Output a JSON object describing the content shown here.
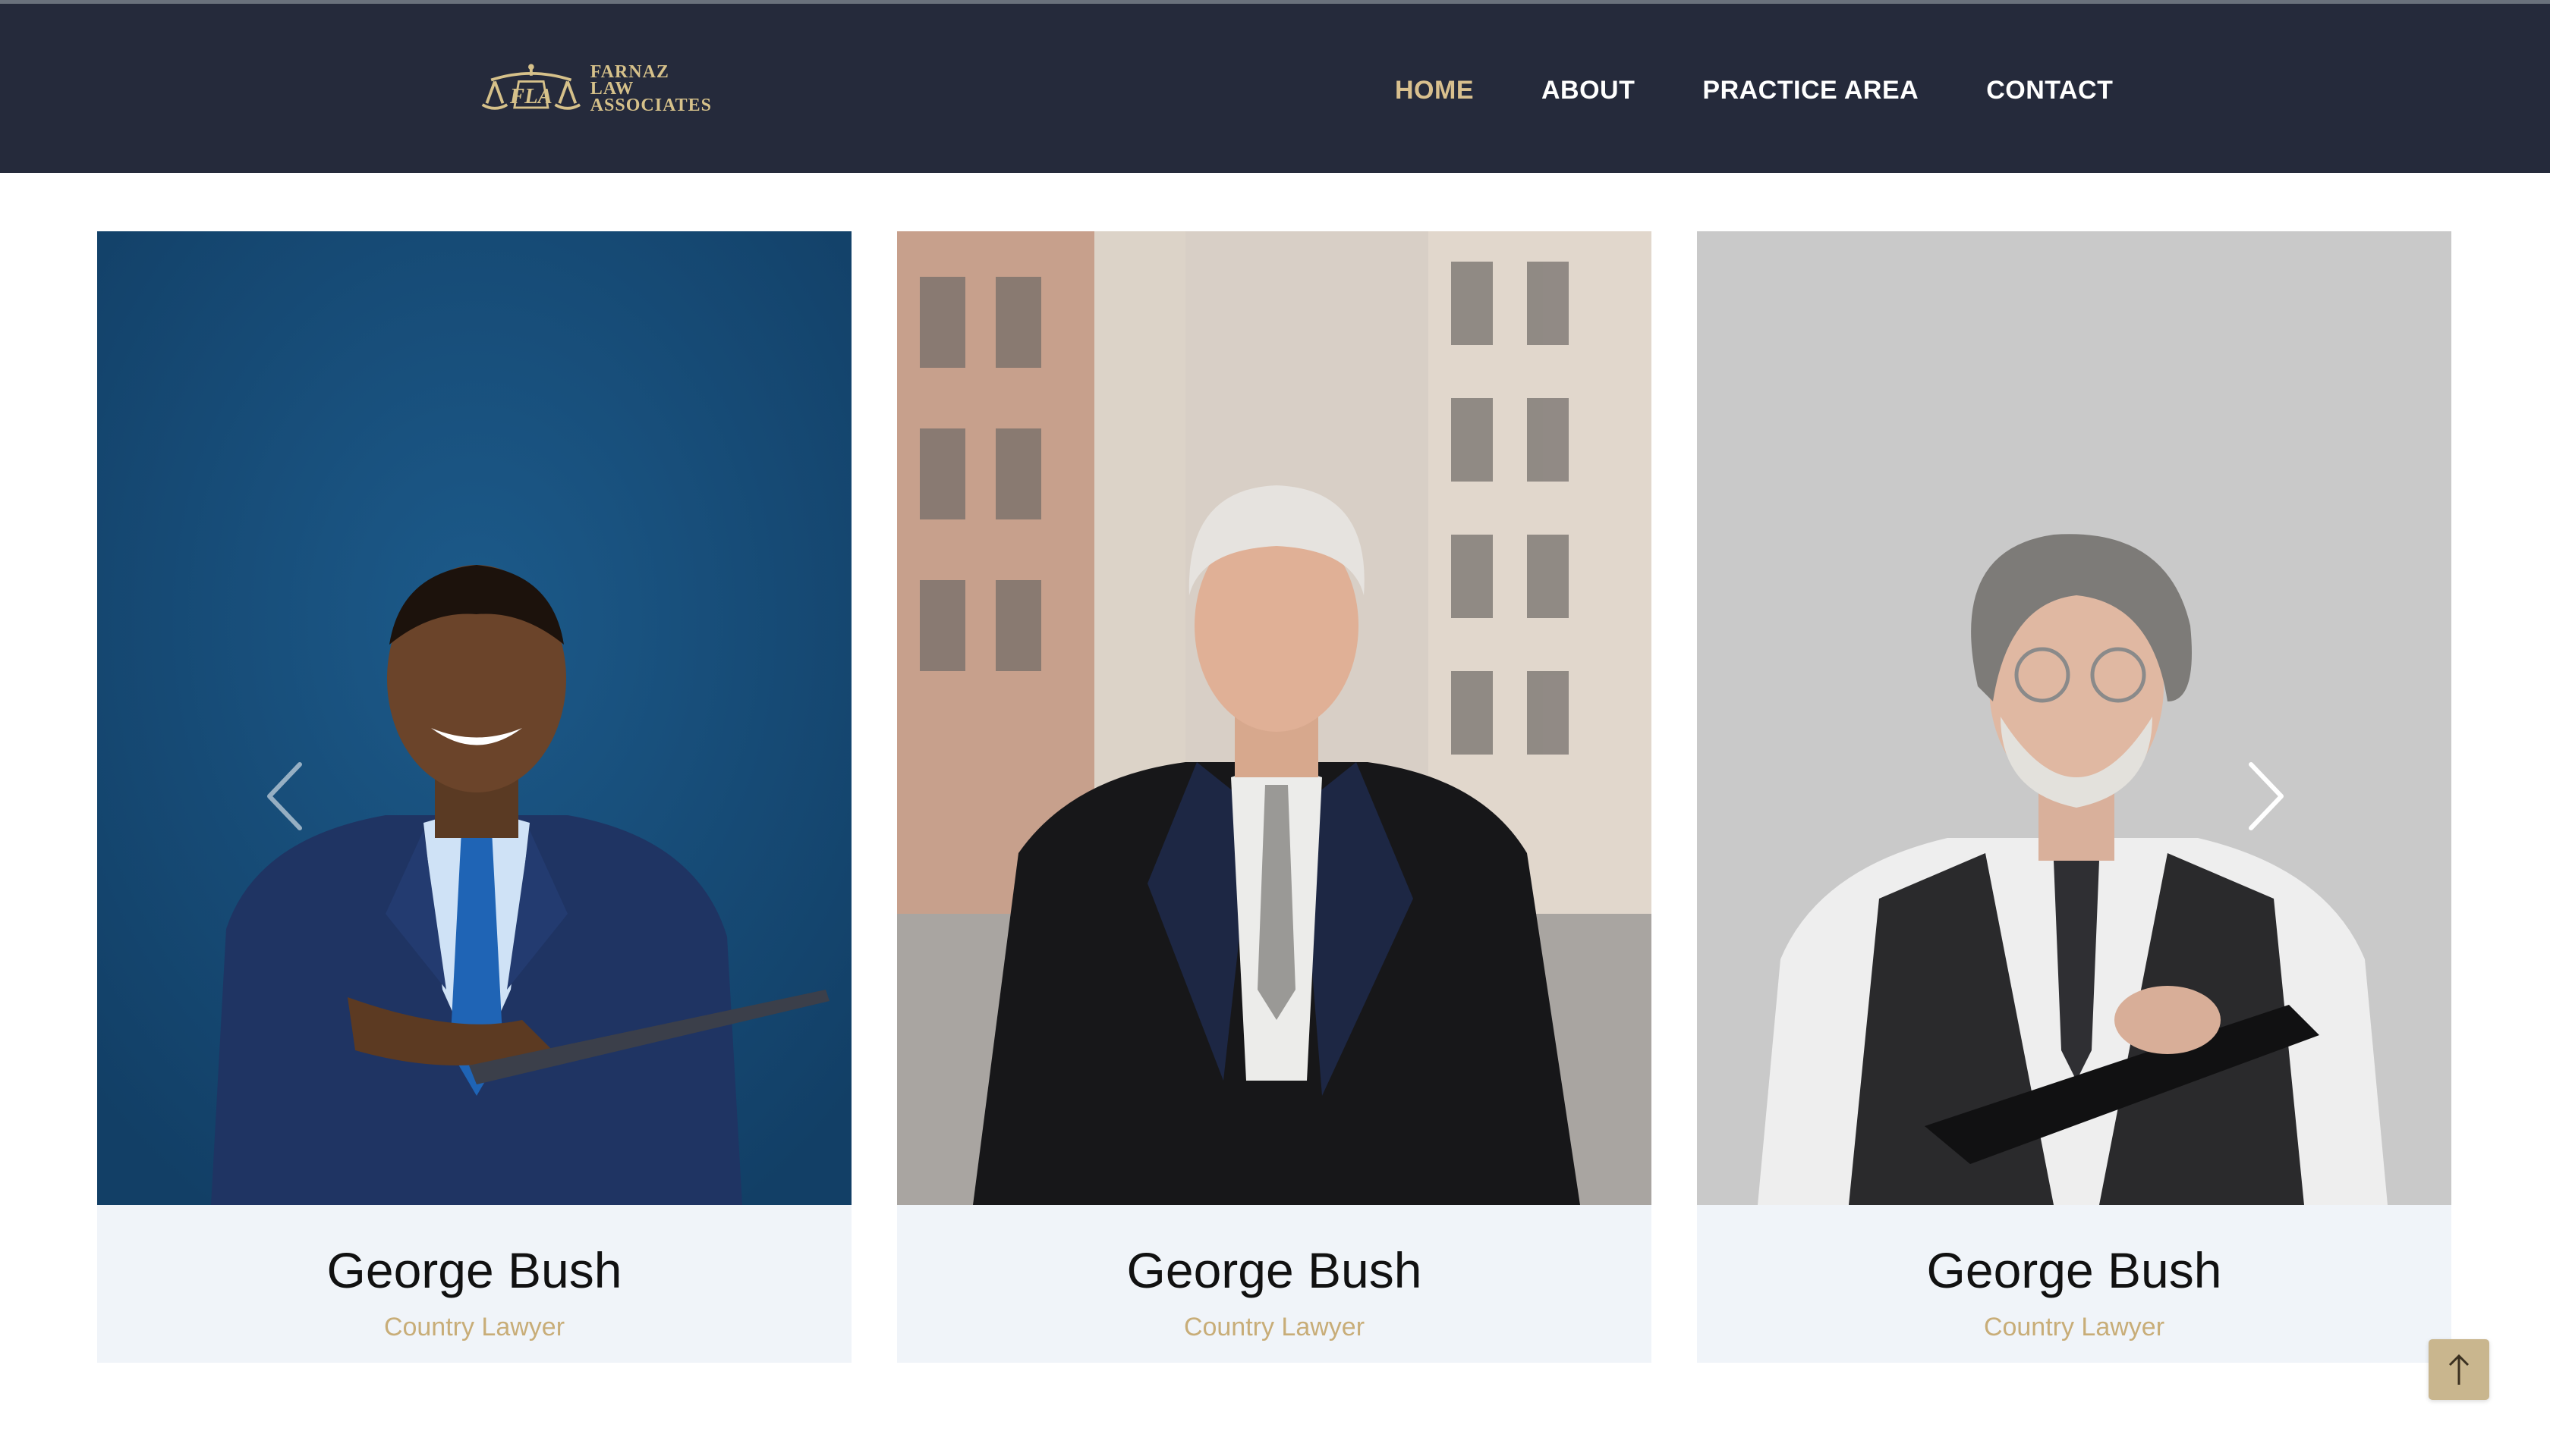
{
  "header": {
    "logo": {
      "monogram": "FLA",
      "lines": [
        "FARNAZ",
        "LAW",
        "ASSOCIATES"
      ]
    },
    "nav": [
      {
        "label": "HOME",
        "active": true
      },
      {
        "label": "ABOUT",
        "active": false
      },
      {
        "label": "PRACTICE AREA",
        "active": false
      },
      {
        "label": "CONTACT",
        "active": false
      }
    ]
  },
  "team": [
    {
      "name": "George Bush",
      "role": "Country Lawyer",
      "photo": "lawyer-photo-blue-suit-tablet"
    },
    {
      "name": "George Bush",
      "role": "Country Lawyer",
      "photo": "lawyer-photo-black-coat-street"
    },
    {
      "name": "George Bush",
      "role": "Country Lawyer",
      "photo": "lawyer-photo-vest-clipboard"
    }
  ],
  "carousel": {
    "prev_icon": "chevron-left-icon",
    "next_icon": "chevron-right-icon"
  },
  "back_to_top": {
    "icon": "arrow-up-icon"
  },
  "colors": {
    "header_bg": "#252a3b",
    "accent_gold": "#d9c08e",
    "card_info_bg": "#f0f4f9",
    "role_text": "#c8ad78"
  }
}
